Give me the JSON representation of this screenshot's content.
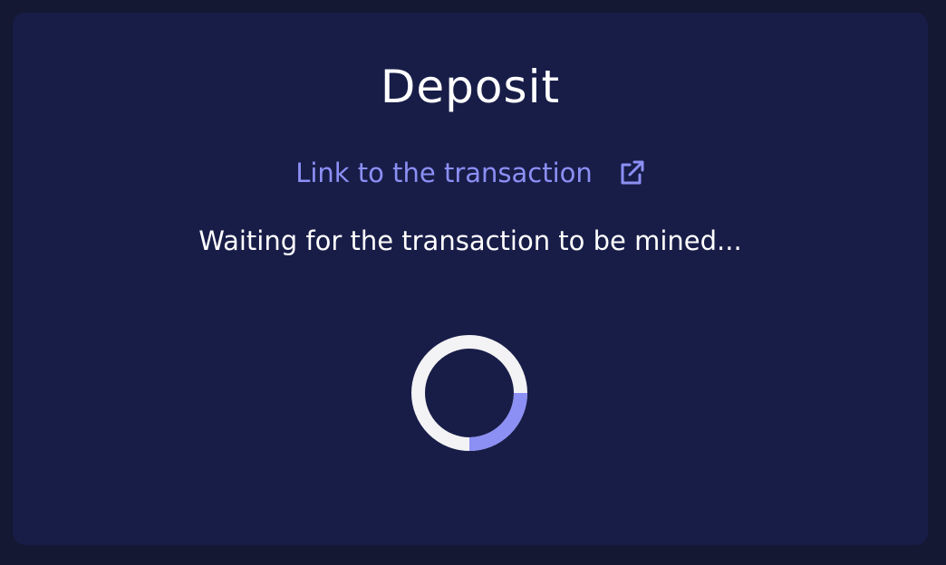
{
  "modal": {
    "title": "Deposit",
    "link_label": "Link to the transaction",
    "link_icon": "external-link-icon",
    "status_text": "Waiting for the transaction to be mined...",
    "spinner_icon": "loading-spinner-icon",
    "spinner_progress": 0.25
  },
  "colors": {
    "page_background": "#141833",
    "card_background": "#181d48",
    "accent": "#8c8ff4",
    "text": "#ffffff",
    "spinner_track": "#f3f3f5"
  }
}
